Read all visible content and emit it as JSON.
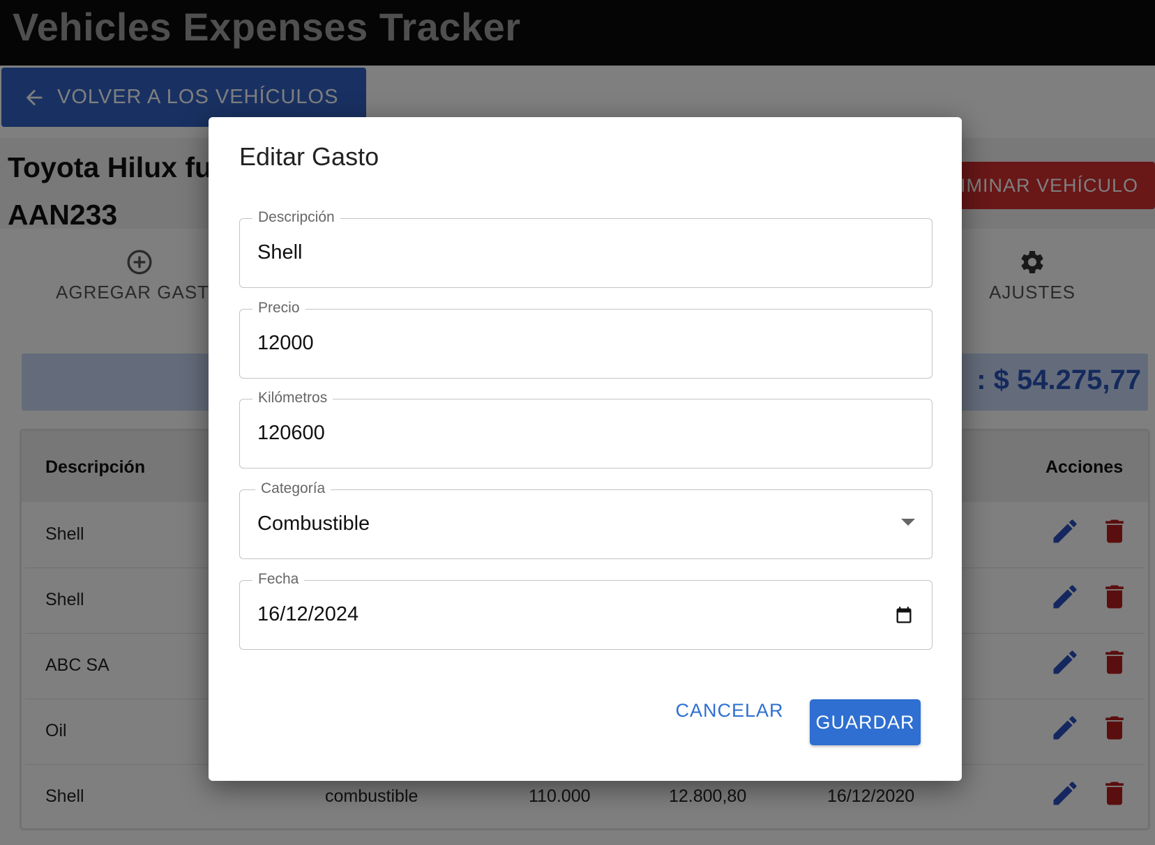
{
  "app": {
    "title": "Vehicles Expenses Tracker"
  },
  "back_button": {
    "label": "VOLVER A LOS VEHÍCULOS",
    "icon": "arrow-left-icon"
  },
  "vehicle": {
    "name_line1": "Toyota Hilux fu",
    "name_line2": "AAN233"
  },
  "delete_vehicle_button": {
    "label": "ELIMINAR VEHÍCULO"
  },
  "toolbar": {
    "add_expense": {
      "label": "AGREGAR GASTO",
      "icon": "plus-circle-icon"
    },
    "settings": {
      "label": "AJUSTES",
      "icon": "gear-icon"
    }
  },
  "summary": {
    "total_text": ": $ 54.275,77"
  },
  "table": {
    "headers": {
      "description": "Descripción",
      "actions": "Acciones"
    },
    "rows": [
      {
        "description": "Shell"
      },
      {
        "description": "Shell"
      },
      {
        "description": "ABC SA"
      },
      {
        "description": "Oil"
      },
      {
        "description": "Shell",
        "category": "combustible",
        "price": "110.000",
        "km": "12.800,80",
        "date": "16/12/2020"
      }
    ]
  },
  "dialog": {
    "title": "Editar Gasto",
    "fields": {
      "description": {
        "label": "Descripción",
        "value": "Shell"
      },
      "price": {
        "label": "Precio",
        "value": "12000"
      },
      "kilometers": {
        "label": "Kilómetros",
        "value": "120600"
      },
      "category": {
        "label": "Categoría",
        "value": "Combustible"
      },
      "date": {
        "label": "Fecha",
        "value": "16/12/2024"
      }
    },
    "cancel_label": "CANCELAR",
    "save_label": "GUARDAR"
  },
  "colors": {
    "primary": "#2e6fd1",
    "danger": "#d32f2f",
    "appbar": "#0a0a0a"
  }
}
